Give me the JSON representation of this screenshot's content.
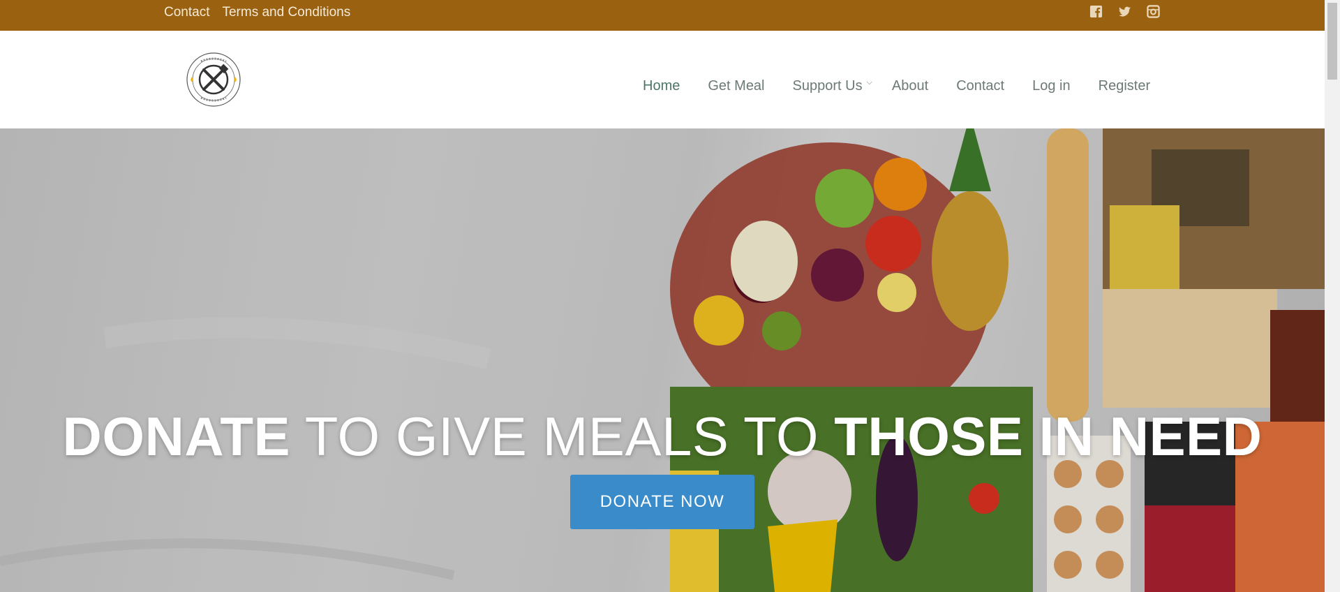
{
  "topbar": {
    "links": [
      "Contact",
      "Terms and Conditions"
    ],
    "social_icons": [
      "facebook-icon",
      "twitter-icon",
      "instagram-icon"
    ],
    "color": "#9a6110"
  },
  "header": {
    "logo": "logo",
    "nav": {
      "home": "Home",
      "get_meal": "Get Meal",
      "support_us": "Support Us",
      "about": "About",
      "contact": "Contact",
      "login": "Log in",
      "register": "Register"
    },
    "active_color": "#4d7568"
  },
  "hero": {
    "title_part1": "DONATE",
    "title_part2": " TO GIVE MEALS TO ",
    "title_part3": "THOSE IN NEED",
    "button_label": "DONATE NOW",
    "button_color": "#3a8bc9"
  }
}
